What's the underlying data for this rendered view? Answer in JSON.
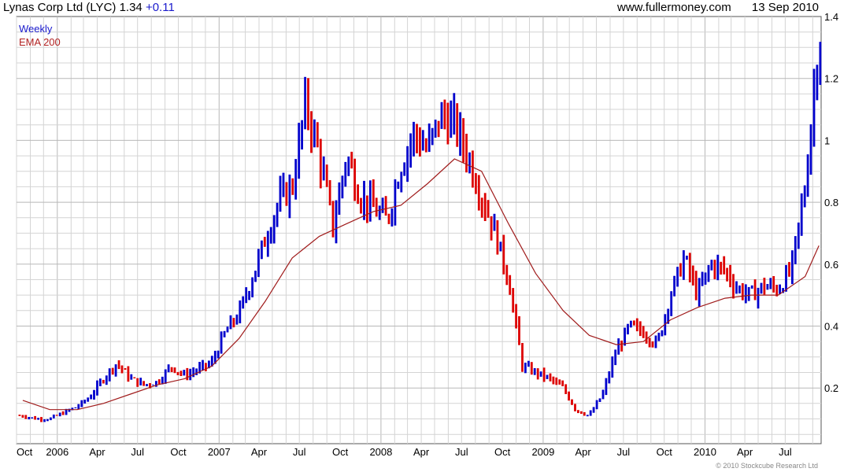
{
  "header": {
    "title": "Lynas Corp Ltd (LYC)",
    "price": "1.34",
    "change": "+0.11",
    "site": "www.fullermoney.com",
    "date": "13 Sep 2010"
  },
  "colors": {
    "up": "#0000cc",
    "down": "#dd0000",
    "ema": "#a01c1c",
    "grid": "#d4d4d4",
    "grid_major": "#b8b8b8"
  },
  "footer": {
    "copyright": "© 2010 Stockcube Research Ltd"
  },
  "chart_data": {
    "type": "line",
    "legend": [
      "Weekly",
      "EMA 200"
    ],
    "legend_position": "top-left",
    "grid": true,
    "ylim": [
      0.02,
      1.4
    ],
    "y_ticks": [
      0.2,
      0.4,
      0.6,
      0.8,
      1.0,
      1.2,
      1.4
    ],
    "y_tick_labels": [
      "0.2",
      "0.4",
      "0.6",
      "0.8",
      "1",
      "1.2",
      "1.4"
    ],
    "x_labels": [
      "Oct",
      "2006",
      "Apr",
      "Jul",
      "Oct",
      "2007",
      "Apr",
      "Jul",
      "Oct",
      "2008",
      "Apr",
      "Jul",
      "Oct",
      "2009",
      "Apr",
      "Jul",
      "Oct",
      "2010",
      "Apr",
      "Jul"
    ],
    "major_x_labels": [
      "2006",
      "2007",
      "2008",
      "2009",
      "2010"
    ],
    "series": [
      {
        "name": "Weekly",
        "x": [
          "2005-10",
          "2005-11",
          "2005-12",
          "2006-01",
          "2006-02",
          "2006-03",
          "2006-04",
          "2006-05",
          "2006-06",
          "2006-07",
          "2006-08",
          "2006-09",
          "2006-10",
          "2006-11",
          "2006-12",
          "2007-01",
          "2007-02",
          "2007-03",
          "2007-04",
          "2007-05",
          "2007-06",
          "2007-07",
          "2007-08",
          "2007-09",
          "2007-10",
          "2007-11",
          "2007-12",
          "2008-01",
          "2008-02",
          "2008-03",
          "2008-04",
          "2008-05",
          "2008-06",
          "2008-07",
          "2008-08",
          "2008-09",
          "2008-10",
          "2008-11",
          "2008-12",
          "2009-01",
          "2009-02",
          "2009-03",
          "2009-04",
          "2009-05",
          "2009-06",
          "2009-07",
          "2009-08",
          "2009-09",
          "2009-10",
          "2009-11",
          "2009-12",
          "2010-01",
          "2010-02",
          "2010-03",
          "2010-04",
          "2010-05",
          "2010-06",
          "2010-07",
          "2010-08",
          "2010-09"
        ],
        "values": [
          0.11,
          0.1,
          0.1,
          0.12,
          0.14,
          0.17,
          0.23,
          0.28,
          0.23,
          0.21,
          0.22,
          0.27,
          0.24,
          0.26,
          0.28,
          0.38,
          0.44,
          0.55,
          0.68,
          0.8,
          0.85,
          1.12,
          0.95,
          0.72,
          0.95,
          0.82,
          0.78,
          0.74,
          0.92,
          1.02,
          0.97,
          1.08,
          1.05,
          0.95,
          0.82,
          0.7,
          0.55,
          0.27,
          0.25,
          0.23,
          0.2,
          0.13,
          0.11,
          0.18,
          0.32,
          0.4,
          0.38,
          0.34,
          0.5,
          0.62,
          0.5,
          0.6,
          0.58,
          0.52,
          0.5,
          0.53,
          0.52,
          0.58,
          0.85,
          1.34
        ]
      },
      {
        "name": "EMA 200",
        "x": [
          "2005-10",
          "2005-12",
          "2006-02",
          "2006-04",
          "2006-06",
          "2006-08",
          "2006-10",
          "2006-12",
          "2007-02",
          "2007-04",
          "2007-06",
          "2007-08",
          "2007-10",
          "2007-12",
          "2008-02",
          "2008-04",
          "2008-06",
          "2008-08",
          "2008-10",
          "2008-12",
          "2009-02",
          "2009-04",
          "2009-06",
          "2009-08",
          "2009-10",
          "2009-12",
          "2010-02",
          "2010-04",
          "2010-06",
          "2010-08",
          "2010-09"
        ],
        "values": [
          0.16,
          0.13,
          0.13,
          0.15,
          0.18,
          0.21,
          0.23,
          0.27,
          0.36,
          0.48,
          0.62,
          0.69,
          0.73,
          0.77,
          0.79,
          0.86,
          0.94,
          0.9,
          0.73,
          0.57,
          0.45,
          0.37,
          0.34,
          0.35,
          0.42,
          0.46,
          0.49,
          0.5,
          0.5,
          0.56,
          0.66
        ]
      }
    ]
  }
}
